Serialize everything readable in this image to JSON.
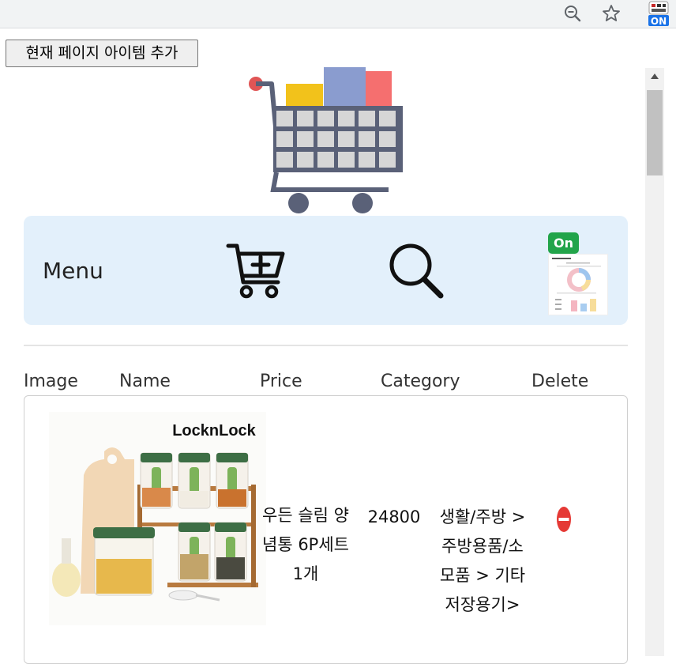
{
  "browser": {
    "icons": [
      "zoom-out-icon",
      "star-icon"
    ],
    "extension_badge": "ON"
  },
  "toolbar": {
    "add_button_label": "현재 페이지 아이템 추가"
  },
  "menu": {
    "label": "Menu",
    "icons": [
      "cart-add-icon",
      "search-icon"
    ],
    "status_badge": "On",
    "bg_color": "#e3f0fb"
  },
  "table": {
    "headers": {
      "image": "Image",
      "name": "Name",
      "price": "Price",
      "category": "Category",
      "delete": "Delete"
    },
    "rows": [
      {
        "image_brand": "LocknLock",
        "name": "우든 슬림 양념통 6P세트 1개",
        "price": "24800",
        "category": "생활/주방 > 주방용품/소모품 > 기타저장용기>"
      }
    ]
  },
  "colors": {
    "delete": "#e53935",
    "on_badge": "#22a44a"
  }
}
